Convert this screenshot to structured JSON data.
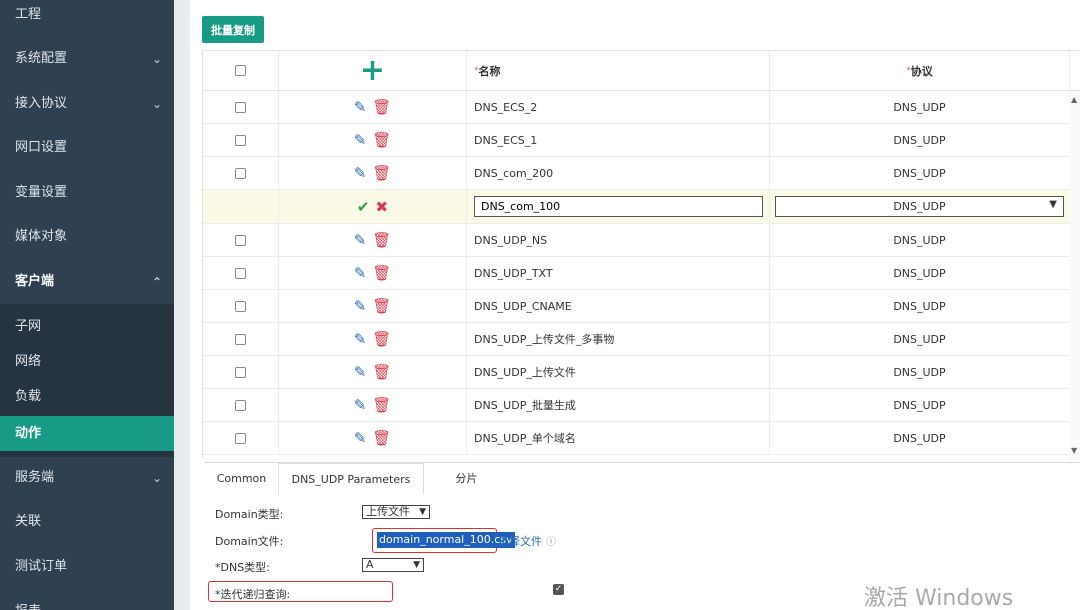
{
  "sidebar": {
    "items": [
      {
        "label": "工程"
      },
      {
        "label": "系统配置"
      },
      {
        "label": "接入协议"
      },
      {
        "label": "网口设置"
      },
      {
        "label": "变量设置"
      },
      {
        "label": "媒体对象"
      },
      {
        "label": "客户端"
      },
      {
        "label": "服务端"
      },
      {
        "label": "关联"
      },
      {
        "label": "测试订单"
      },
      {
        "label": "报表"
      }
    ],
    "sub_items": [
      {
        "label": "子网"
      },
      {
        "label": "网络"
      },
      {
        "label": "负载"
      },
      {
        "label": "动作"
      }
    ]
  },
  "toolbar": {
    "batch_copy_label": "批量复制"
  },
  "grid": {
    "headers": {
      "name": "名称",
      "protocol": "协议",
      "required_mark": "*"
    },
    "rows": [
      {
        "name": "DNS_ECS_2",
        "protocol": "DNS_UDP"
      },
      {
        "name": "DNS_ECS_1",
        "protocol": "DNS_UDP"
      },
      {
        "name": "DNS_com_200",
        "protocol": "DNS_UDP"
      },
      {
        "name": "DNS_com_100",
        "protocol": "DNS_UDP"
      },
      {
        "name": "DNS_UDP_NS",
        "protocol": "DNS_UDP"
      },
      {
        "name": "DNS_UDP_TXT",
        "protocol": "DNS_UDP"
      },
      {
        "name": "DNS_UDP_CNAME",
        "protocol": "DNS_UDP"
      },
      {
        "name": "DNS_UDP_上传文件_多事物",
        "protocol": "DNS_UDP"
      },
      {
        "name": "DNS_UDP_上传文件",
        "protocol": "DNS_UDP"
      },
      {
        "name": "DNS_UDP_批量生成",
        "protocol": "DNS_UDP"
      },
      {
        "name": "DNS_UDP_单个域名",
        "protocol": "DNS_UDP"
      }
    ],
    "editing_row_index": 3
  },
  "tabs": [
    {
      "label": "Common"
    },
    {
      "label": "DNS_UDP Parameters"
    },
    {
      "label": "分片"
    }
  ],
  "form": {
    "domain_type_label": "Domain类型:",
    "domain_type_value": "上传文件",
    "domain_file_label": "Domain文件:",
    "domain_file_value": "domain_normal_100.csv",
    "choose_file_label": "选择文件",
    "dns_type_label": "*DNS类型:",
    "dns_type_value": "A",
    "recursive_label": "*迭代递归查询:"
  },
  "watermark": "激活 Windows",
  "colors": {
    "sidebar_bg": "#2f4050",
    "accent": "#179a86",
    "delete": "#d93a4b",
    "edit": "#2a6fb0",
    "highlight": "#e03030"
  }
}
